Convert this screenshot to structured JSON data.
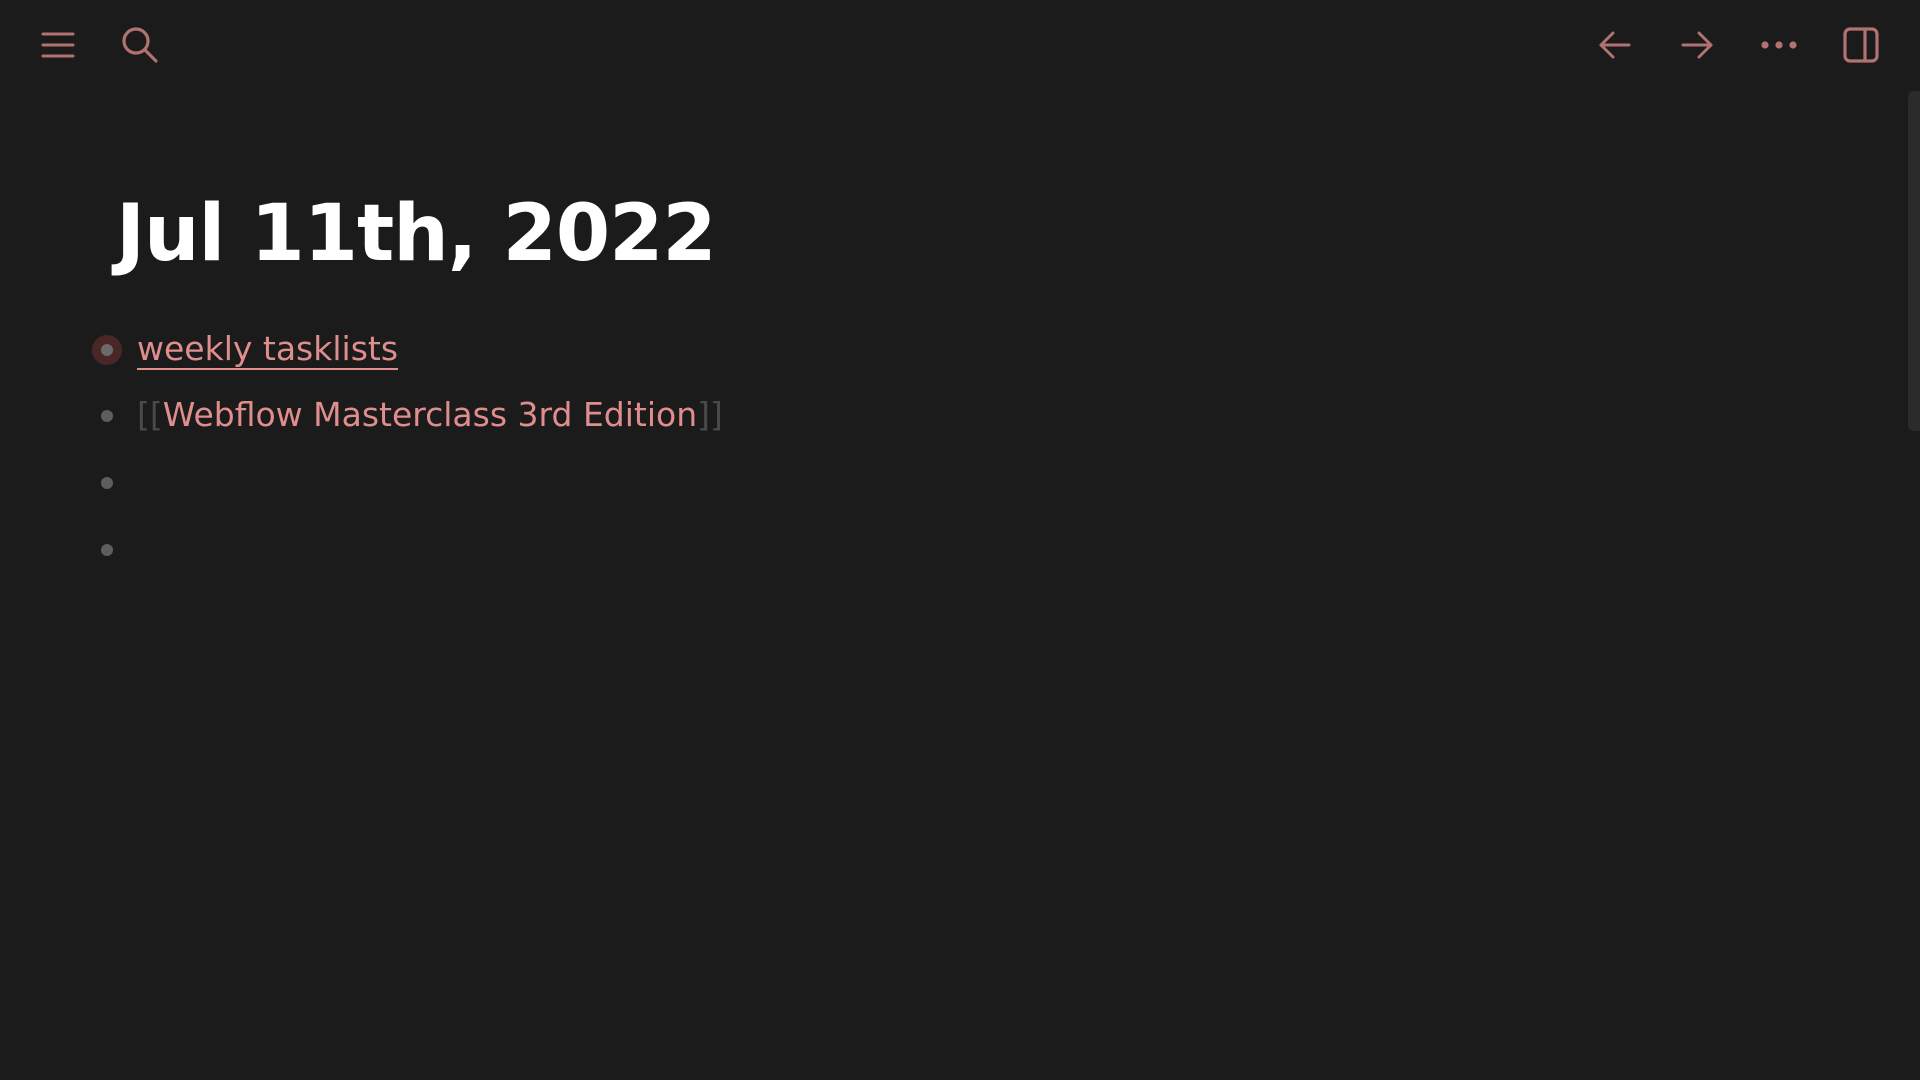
{
  "topbar": {
    "left_icons": [
      "menu-icon",
      "search-icon"
    ],
    "right_icons": [
      "arrow-left-icon",
      "arrow-right-icon",
      "more-icon",
      "sidebar-toggle-icon"
    ]
  },
  "colors": {
    "background": "#1b1b1b",
    "accent": "#e08d8d",
    "icon": "#b27272",
    "title": "#ffffff",
    "bullet": "#5e5e5e",
    "bracket": "#4a4a4a"
  },
  "page": {
    "title": "Jul 11th, 2022",
    "blocks": [
      {
        "type": "page-ref",
        "collapsed": true,
        "text": "weekly tasklists"
      },
      {
        "type": "link",
        "open_bracket": "[[",
        "text": "Webflow Masterclass 3rd Edition",
        "close_bracket": "]]"
      },
      {
        "type": "empty",
        "text": ""
      },
      {
        "type": "empty",
        "text": ""
      }
    ]
  }
}
